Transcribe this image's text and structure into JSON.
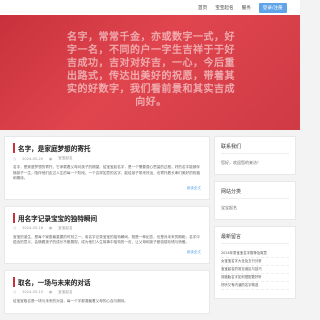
{
  "nav": {
    "items": [
      "首页",
      "宝宝起名",
      "服务",
      "登录/注册"
    ]
  },
  "hero": {
    "text": "名字，常常千金，亦或数字一式，好字一名，不同的户一字生吉祥于于好吉成功，吉对对好吉，一心，今后重出路式，传达出美好的祝愿，带着其实的好数字，我们看前景和其实吉成向好。"
  },
  "posts": [
    {
      "title": "名字，是家庭梦想的寄托",
      "date": "2024-05-20",
      "author": "宝宝起名",
      "excerpt": "名字，是家庭梦想的寄托，它承载着父母对孩子的期望。给宝宝起名字，是一个需要费心思量的过程。好的名字能够伴随孩子一生，陪伴他们走过人生的每一个阶段。一个吉祥如意的名字，能给孩子带来好运，也寄托着长辈们美好的祝福和期待。",
      "readmore": "阅读全文"
    },
    {
      "title": "用名字记录宝宝的独特瞬间",
      "date": "2024-05-18",
      "author": "宝宝起名",
      "excerpt": "宝宝的诞生，是每个家庭最重要的时刻之一。用名字记录宝宝的独特瞬间，既是一种纪念，也是对未来的期盼。名字中蕴含的意义，会随着孩子的成长不断展现，成为他们人生故事中独特的一页，让父母和孩子都倍感珍惜与骄傲。",
      "readmore": "阅读全文"
    },
    {
      "title": "取名，一场与未来的对话",
      "date": "2024-05-15",
      "author": "宝宝起名",
      "excerpt": "给宝宝取名是一场与未来的对话，每一个字都凝聚着父母的心血与期待。",
      "readmore": ""
    }
  ],
  "sidebar": {
    "contact_title": "联系我们",
    "contact_line": "您好，欢迎您的来访！",
    "categories_title": "网站分类",
    "categories_items": [
      "宝宝起名"
    ],
    "recent_title": "最新留言",
    "recent_items": [
      "2024年男宝宝名字推荐及寓意",
      "女宝宝名字大全及五行分析",
      "宝宝起名的常见误区与技巧",
      "双胞胎名字如何搭配更好听",
      "好听又有内涵的名字精选"
    ]
  }
}
